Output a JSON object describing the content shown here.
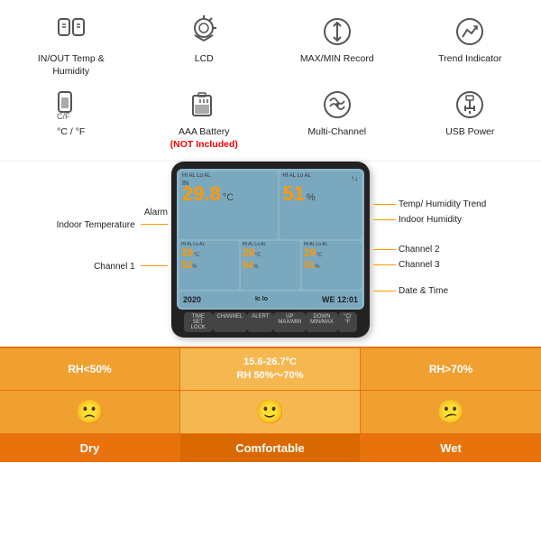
{
  "features": {
    "row1": [
      {
        "id": "in-out-temp",
        "label": "IN/OUT Temp &\nHumidity",
        "icon": "thermometer-double"
      },
      {
        "id": "lcd",
        "label": "LCD",
        "icon": "lcd-screen"
      },
      {
        "id": "max-min",
        "label": "MAX/MIN Record",
        "icon": "max-min-arrows"
      },
      {
        "id": "trend",
        "label": "Trend Indicator",
        "icon": "trend-icon"
      }
    ],
    "row2": [
      {
        "id": "cf",
        "label": "°C / °F",
        "icon": "cf-icon"
      },
      {
        "id": "battery",
        "label": "AAA Battery\n(NOT Included)",
        "icon": "battery-icon",
        "hasRed": true,
        "redText": "(NOT Included)"
      },
      {
        "id": "multichannel",
        "label": "Multi-Channel",
        "icon": "multichannel-icon"
      },
      {
        "id": "usb",
        "label": "USB Power",
        "icon": "usb-icon"
      }
    ]
  },
  "device": {
    "lcd": {
      "alarmLabel": "HI AL  Lo AL",
      "inLabel": "IN",
      "mainTemp": "29.8",
      "tempUnit": "°C",
      "humidity": "51",
      "humUnit": "%",
      "channels": [
        {
          "alarm": "HI AL  Lo AL",
          "temp": "29",
          "unit": "°C",
          "hum": "52",
          "humUnit": "%"
        },
        {
          "alarm": "HI AL  Lo AL",
          "temp": "29",
          "unit": "°C",
          "hum": "54",
          "humUnit": "%"
        },
        {
          "alarm": "HI AL  Lo AL",
          "temp": "29",
          "unit": "°C",
          "hum": "51",
          "humUnit": "%"
        }
      ],
      "date": "2020",
      "dateRight": "WE  12:01"
    },
    "buttons": [
      "TIME SET\nLOCK",
      "CHANNEL",
      "ALERT",
      "UP\nMAX/MIN",
      "DOWN\nMIN/MAX",
      "°C/°F"
    ]
  },
  "annotations": {
    "left": [
      {
        "id": "alarm-indoor",
        "text": "Alarm\nIndoor Temperature",
        "topPct": 38
      },
      {
        "id": "channel1",
        "text": "Channel 1",
        "topPct": 54
      }
    ],
    "right": [
      {
        "id": "temp-hum-trend",
        "text": "Temp/ Humidity Trend",
        "topPct": 38
      },
      {
        "id": "indoor-hum",
        "text": "Indoor Humidity",
        "topPct": 44
      },
      {
        "id": "channel2",
        "text": "Channel 2",
        "topPct": 54
      },
      {
        "id": "channel3",
        "text": "Channel 3",
        "topPct": 62
      },
      {
        "id": "date-time",
        "text": "Date & Time",
        "topPct": 71
      }
    ]
  },
  "humidity": {
    "ranges": [
      {
        "id": "dry-range",
        "text": "RH<50%",
        "style": "normal"
      },
      {
        "id": "comfortable-range",
        "text": "15.6-26.7°C\nRH 50%～70%",
        "style": "light"
      },
      {
        "id": "wet-range",
        "text": "RH>70%",
        "style": "normal"
      }
    ],
    "faces": [
      {
        "id": "dry-face",
        "glyph": "🙁",
        "style": "normal"
      },
      {
        "id": "comfortable-face",
        "glyph": "🙂",
        "style": "light"
      },
      {
        "id": "wet-face",
        "glyph": "😕",
        "style": "normal"
      }
    ],
    "labels": [
      {
        "id": "dry-label",
        "text": "Dry",
        "style": "label"
      },
      {
        "id": "comfortable-label",
        "text": "Comfortable",
        "style": "label"
      },
      {
        "id": "wet-label",
        "text": "Wet",
        "style": "label"
      }
    ]
  }
}
